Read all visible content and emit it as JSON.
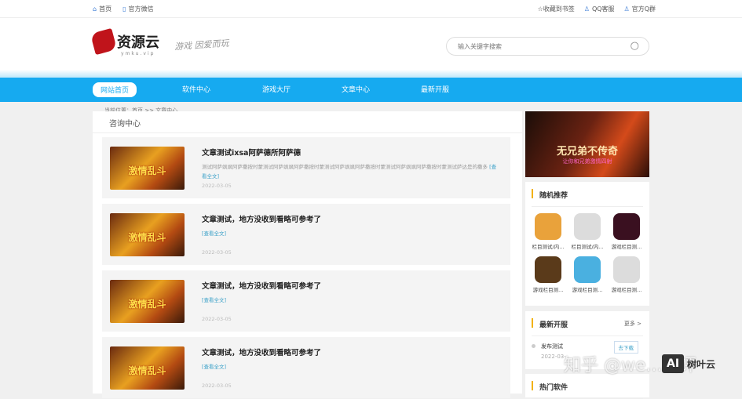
{
  "topbar": {
    "home": "首页",
    "wechat": "官方微信",
    "bookmark": "收藏到书签",
    "qq_service": "QQ客服",
    "qq_group": "官方Q群"
  },
  "header": {
    "logo": "资源云",
    "logo_sub": "ymku.vip",
    "slogan": "游戏 因爱而玩",
    "search_placeholder": "输入关键字搜索"
  },
  "nav": [
    "网站首页",
    "软件中心",
    "游戏大厅",
    "文章中心",
    "最新开服"
  ],
  "breadcrumb": "当前位置：首页 >> 文章中心",
  "main": {
    "title": "咨询中心",
    "read_more": "[查看全文]",
    "thumb_text": "激情乱斗",
    "items": [
      {
        "title": "文章测试ixsa阿萨德所阿萨德",
        "desc": "测试阿萨飒飒阿萨撒按时蒙测试阿萨飒飒阿萨撒按时蒙测试阿萨飒飒阿萨撒按时蒙测试阿萨飒飒阿萨撒按时蒙测试萨达是的撒多",
        "date": "2022-03-05"
      },
      {
        "title": "文章测试，地方没收到看略可参考了",
        "desc": "",
        "date": "2022-03-05"
      },
      {
        "title": "文章测试，地方没收到看略可参考了",
        "desc": "",
        "date": "2022-03-05"
      },
      {
        "title": "文章测试，地方没收到看略可参考了",
        "desc": "",
        "date": "2022-03-05"
      }
    ]
  },
  "banner": {
    "title": "无兄弟不传奇",
    "sub": "让你和兄弟激情四射"
  },
  "random": {
    "title": "随机推荐",
    "apps": [
      {
        "name": "栏目测试/内...",
        "color": "#e9a23b"
      },
      {
        "name": "栏目测试/内...",
        "color": "#dcdcdc"
      },
      {
        "name": "游戏栏目测...",
        "color": "#3a1020"
      },
      {
        "name": "游戏栏目测...",
        "color": "#5a3a1a"
      },
      {
        "name": "游戏栏目测...",
        "color": "#4ab0e0"
      },
      {
        "name": "游戏栏目测...",
        "color": "#dcdcdc"
      }
    ]
  },
  "latest": {
    "title": "最新开服",
    "more": "更多 >",
    "server": "发布测试",
    "date": "2022-03-",
    "button": "去下载"
  },
  "hot": {
    "title": "热门软件"
  },
  "watermark": {
    "text": "知乎 @we...测评",
    "brand": "树叶云",
    "ai": "AI"
  }
}
